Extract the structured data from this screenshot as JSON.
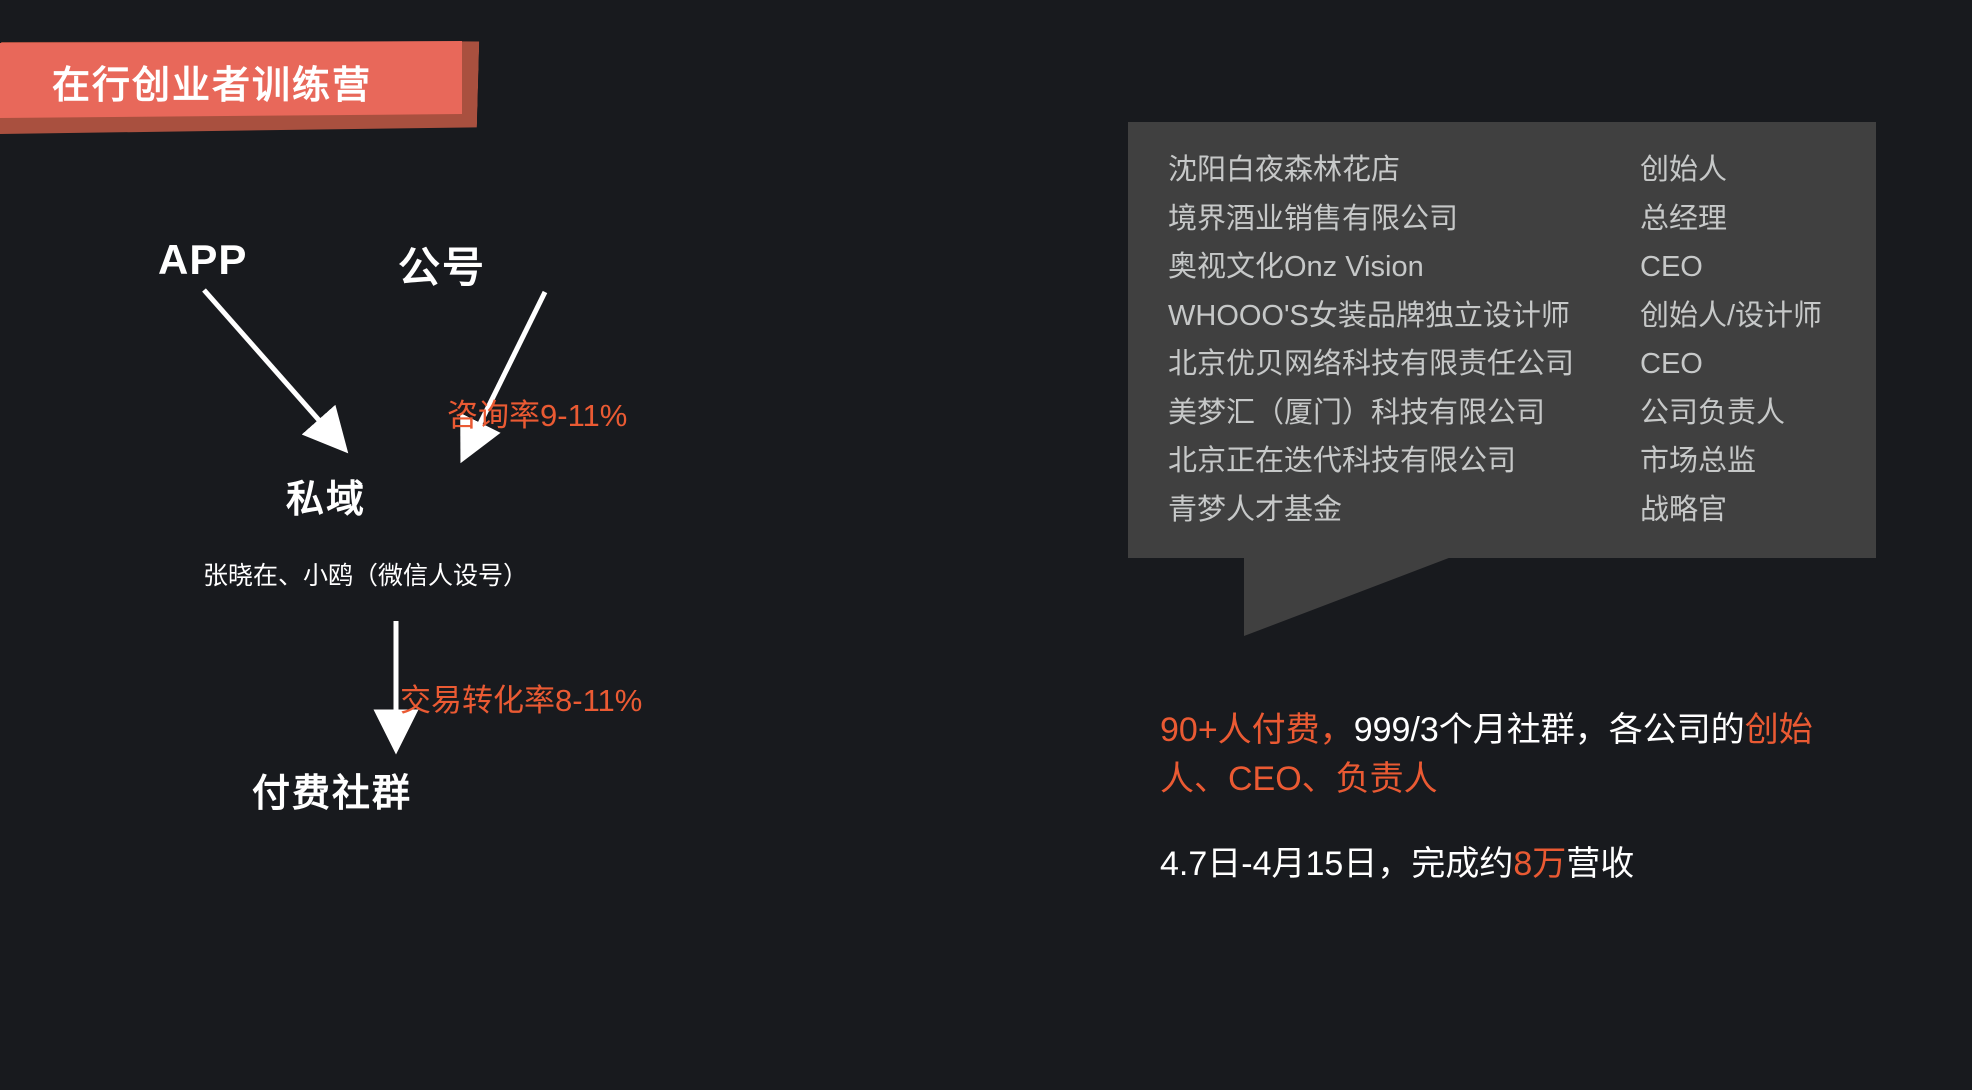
{
  "slide": {
    "background_color": "#181a1e",
    "accent_color": "#ea5a33",
    "ribbon_color": "#e8685a",
    "ribbon_shadow_color": "#a9503f",
    "bubble_color": "#404040"
  },
  "title": {
    "text": "在行创业者训练营"
  },
  "diagram": {
    "nodes": {
      "app": "APP",
      "official_account": "公号",
      "private_domain": "私域",
      "private_domain_sub": "张晓在、小鸥（微信人设号）",
      "paid_community": "付费社群"
    },
    "rates": {
      "consult": "咨询率9-11%",
      "trade": "交易转化率8-11%"
    }
  },
  "bubble": {
    "rows": [
      {
        "company": "沈阳白夜森林花店",
        "role": "创始人"
      },
      {
        "company": "境界酒业销售有限公司",
        "role": "总经理"
      },
      {
        "company": "奥视文化Onz Vision",
        "role": "CEO"
      },
      {
        "company": "WHOOO'S女装品牌独立设计师",
        "role": "创始人/设计师"
      },
      {
        "company": "北京优贝网络科技有限责任公司",
        "role": "CEO"
      },
      {
        "company": "美梦汇（厦门）科技有限公司",
        "role": "公司负责人"
      },
      {
        "company": "北京正在迭代科技有限公司",
        "role": "市场总监"
      },
      {
        "company": "青梦人才基金",
        "role": "战略官"
      }
    ]
  },
  "summary": {
    "line1_part1": "90+人付费，",
    "line1_part2": "999/3个月社群，各公司的",
    "line1_part3": "创始人、CEO、负责人",
    "line2_part1": "4.7日-4月15日，完成约",
    "line2_part2": "8万",
    "line2_part3": "营收"
  }
}
